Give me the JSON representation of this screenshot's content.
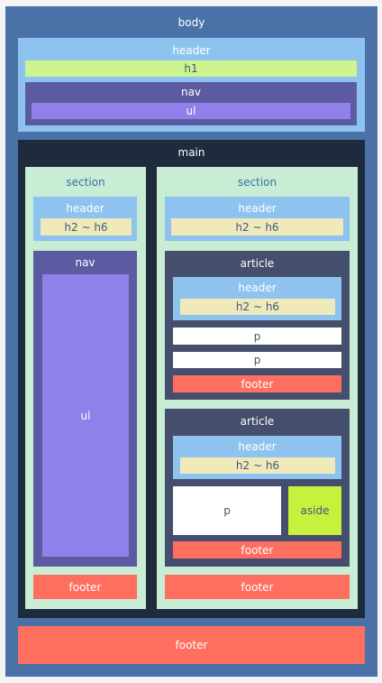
{
  "body": {
    "label": "body"
  },
  "top_header": {
    "label": "header",
    "h1": "h1",
    "nav": {
      "label": "nav",
      "ul": "ul"
    }
  },
  "main": {
    "label": "main",
    "section_left": {
      "label": "section",
      "header": {
        "label": "header",
        "heading": "h2 ~ h6"
      },
      "nav": {
        "label": "nav",
        "ul": "ul"
      },
      "footer": "footer"
    },
    "section_right": {
      "label": "section",
      "header": {
        "label": "header",
        "heading": "h2 ~ h6"
      },
      "article1": {
        "label": "article",
        "header": {
          "label": "header",
          "heading": "h2 ~ h6"
        },
        "p1": "p",
        "p2": "p",
        "footer": "footer"
      },
      "article2": {
        "label": "article",
        "header": {
          "label": "header",
          "heading": "h2 ~ h6"
        },
        "p": "p",
        "aside": "aside",
        "footer": "footer"
      },
      "footer": "footer"
    }
  },
  "page_footer": "footer",
  "colors": {
    "body": "#4a72a8",
    "header": "#8fc3ef",
    "h1": "#cdf48e",
    "nav": "#5c5ba2",
    "ul": "#8f81ea",
    "main": "#1e2b3c",
    "section": "#c9edd4",
    "heading": "#f0eabb",
    "article": "#454e6c",
    "p": "#ffffff",
    "aside": "#c6f13d",
    "footer": "#fe6f5f"
  }
}
